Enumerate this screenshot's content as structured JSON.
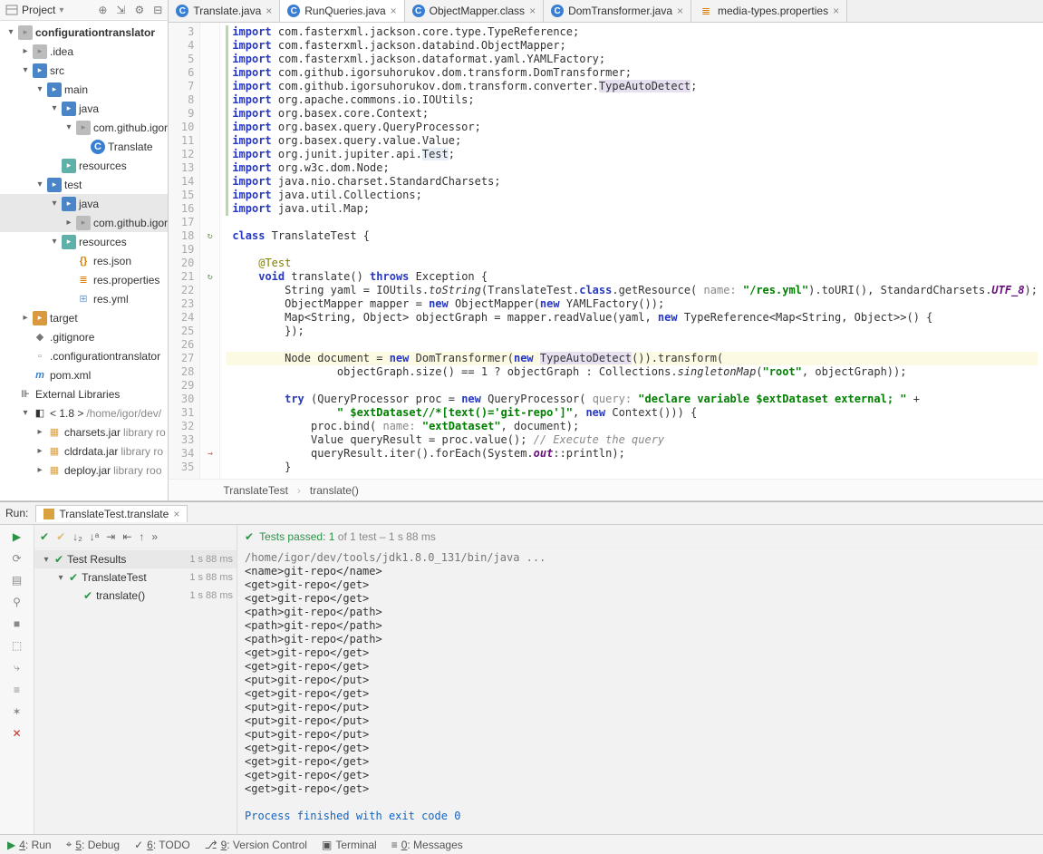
{
  "project_panel": {
    "title": "Project",
    "tree": [
      {
        "d": 0,
        "a": "down",
        "i": "folder",
        "ic": "gray",
        "l": "configurationtranslator",
        "bold": true,
        "hl": false
      },
      {
        "d": 1,
        "a": "right",
        "i": "folder",
        "ic": "gray",
        "l": ".idea"
      },
      {
        "d": 1,
        "a": "down",
        "i": "folder",
        "ic": "folder",
        "l": "src"
      },
      {
        "d": 2,
        "a": "down",
        "i": "folder",
        "ic": "folder",
        "l": "main"
      },
      {
        "d": 3,
        "a": "down",
        "i": "folder",
        "ic": "folder",
        "l": "java"
      },
      {
        "d": 4,
        "a": "down",
        "i": "folder",
        "ic": "gray",
        "l": "com.github.igor"
      },
      {
        "d": 5,
        "a": "",
        "i": "class",
        "l": "Translate",
        "sel": false
      },
      {
        "d": 3,
        "a": "",
        "i": "folder",
        "ic": "teal",
        "l": "resources"
      },
      {
        "d": 2,
        "a": "down",
        "i": "folder",
        "ic": "folder",
        "l": "test"
      },
      {
        "d": 3,
        "a": "down",
        "i": "folder",
        "ic": "folder",
        "l": "java",
        "hl": true
      },
      {
        "d": 4,
        "a": "right",
        "i": "folder",
        "ic": "gray",
        "l": "com.github.igor",
        "hl": true
      },
      {
        "d": 3,
        "a": "down",
        "i": "folder",
        "ic": "teal",
        "l": "resources"
      },
      {
        "d": 4,
        "a": "",
        "i": "json",
        "l": "res.json"
      },
      {
        "d": 4,
        "a": "",
        "i": "props",
        "l": "res.properties"
      },
      {
        "d": 4,
        "a": "",
        "i": "yml",
        "l": "res.yml"
      },
      {
        "d": 1,
        "a": "right",
        "i": "folder",
        "ic": "orange",
        "l": "target"
      },
      {
        "d": 1,
        "a": "",
        "i": "gitignore",
        "l": ".gitignore"
      },
      {
        "d": 1,
        "a": "",
        "i": "gray",
        "l": ".configurationtranslator"
      },
      {
        "d": 1,
        "a": "",
        "i": "xml",
        "l": "pom.xml"
      },
      {
        "d": 0,
        "a": "",
        "i": "lib",
        "l": "External Libraries"
      },
      {
        "d": 1,
        "a": "down",
        "i": "jdk",
        "l": "< 1.8 >",
        "suffix": "/home/igor/dev/"
      },
      {
        "d": 2,
        "a": "right",
        "i": "jar",
        "l": "charsets.jar",
        "suffix": "library ro"
      },
      {
        "d": 2,
        "a": "right",
        "i": "jar",
        "l": "cldrdata.jar",
        "suffix": "library ro"
      },
      {
        "d": 2,
        "a": "right",
        "i": "jar",
        "l": "deploy.jar",
        "suffix": "library roo"
      }
    ]
  },
  "tabs": [
    {
      "icon": "class",
      "label": "Translate.java"
    },
    {
      "icon": "class",
      "label": "RunQueries.java",
      "active": true
    },
    {
      "icon": "class",
      "label": "ObjectMapper.class"
    },
    {
      "icon": "class",
      "label": "DomTransformer.java"
    },
    {
      "icon": "props",
      "label": "media-types.properties"
    }
  ],
  "editor": {
    "first_line": 3,
    "lines": [
      {
        "n": 3,
        "sb": "g",
        "html": "<span class='kw'>import</span> com.fasterxml.jackson.core.type.TypeReference;"
      },
      {
        "n": 4,
        "sb": "g",
        "html": "<span class='kw'>import</span> com.fasterxml.jackson.databind.ObjectMapper;"
      },
      {
        "n": 5,
        "sb": "g",
        "html": "<span class='kw'>import</span> com.fasterxml.jackson.dataformat.yaml.YAMLFactory;"
      },
      {
        "n": 6,
        "sb": "g",
        "html": "<span class='kw'>import</span> com.github.igorsuhorukov.dom.transform.DomTransformer;"
      },
      {
        "n": 7,
        "sb": "g",
        "html": "<span class='kw'>import</span> com.github.igorsuhorukov.dom.transform.converter.<span style='background:#e6e0f0'>TypeAutoDetect</span>;"
      },
      {
        "n": 8,
        "sb": "g",
        "html": "<span class='kw'>import</span> org.apache.commons.io.IOUtils;"
      },
      {
        "n": 9,
        "sb": "g",
        "html": "<span class='kw'>import</span> org.basex.core.Context;"
      },
      {
        "n": 10,
        "sb": "g",
        "html": "<span class='kw'>import</span> org.basex.query.QueryProcessor;"
      },
      {
        "n": 11,
        "sb": "g",
        "html": "<span class='kw'>import</span> org.basex.query.value.Value;"
      },
      {
        "n": 12,
        "sb": "g",
        "html": "<span class='kw'>import</span> org.junit.jupiter.api.<span style='background:#e8eef6'>Test</span>;"
      },
      {
        "n": 13,
        "sb": "g",
        "html": "<span class='kw'>import</span> org.w3c.dom.Node;"
      },
      {
        "n": 14,
        "sb": "g",
        "html": "<span class='kw'>import</span> java.nio.charset.StandardCharsets;"
      },
      {
        "n": 15,
        "sb": "g",
        "html": "<span class='kw'>import</span> java.util.Collections;"
      },
      {
        "n": 16,
        "sb": "g",
        "html": "<span class='kw'>import</span> java.util.Map;"
      },
      {
        "n": 17,
        "html": ""
      },
      {
        "n": 18,
        "mark": "↻",
        "html": "<span class='kw'>class</span> TranslateTest {"
      },
      {
        "n": 19,
        "html": ""
      },
      {
        "n": 20,
        "html": "    <span class='ann'>@Test</span>"
      },
      {
        "n": 21,
        "mark": "↻",
        "html": "    <span class='kw'>void</span> translate() <span class='kw'>throws</span> Exception {"
      },
      {
        "n": 22,
        "html": "        String yaml = IOUtils.<span class='statm'>toString</span>(TranslateTest.<span class='kw'>class</span>.getResource( <span class='param'>name:</span> <span class='str'>\"/res.yml\"</span>).toURI(), StandardCharsets.<span class='staticfld'>UTF_8</span>);"
      },
      {
        "n": 23,
        "html": "        ObjectMapper mapper = <span class='kw'>new</span> ObjectMapper(<span class='kw'>new</span> YAMLFactory());"
      },
      {
        "n": 24,
        "html": "        Map&lt;String, Object&gt; objectGraph = mapper.readValue(yaml, <span class='kw'>new</span> TypeReference&lt;Map&lt;String, Object&gt;&gt;() {"
      },
      {
        "n": 25,
        "html": "        });"
      },
      {
        "n": 26,
        "html": ""
      },
      {
        "n": 27,
        "hl": true,
        "html": "        Node document = <span class='kw'>new</span> DomTransformer(<span class='kw'>new</span> <span style='background:#e6e0f0'>TypeAutoDetect</span>()).transform("
      },
      {
        "n": 28,
        "html": "                objectGraph.size() == 1 ? objectGraph : Collections.<span class='statm'>singletonMap</span>(<span class='str'>\"root\"</span>, objectGraph));"
      },
      {
        "n": 29,
        "html": ""
      },
      {
        "n": 30,
        "html": "        <span class='kw'>try</span> (QueryProcessor proc = <span class='kw'>new</span> QueryProcessor( <span class='param'>query:</span> <span class='str'>\"declare variable $extDataset external; \"</span> +"
      },
      {
        "n": 31,
        "html": "                <span class='str'>\" $extDataset//*[text()='git-repo']\"</span>, <span class='kw'>new</span> Context())) {"
      },
      {
        "n": 32,
        "html": "            proc.bind( <span class='param'>name:</span> <span class='str'>\"extDataset\"</span>, document);"
      },
      {
        "n": 33,
        "html": "            Value queryResult = proc.value(); <span class='cmt'>// Execute the query</span>"
      },
      {
        "n": 34,
        "mark": "→",
        "html": "            queryResult.iter().forEach(System.<span class='staticfld'>out</span>::println);"
      },
      {
        "n": 35,
        "html": "        }"
      }
    ],
    "breadcrumb": [
      "TranslateTest",
      "translate()"
    ]
  },
  "run": {
    "label": "Run:",
    "tab": "TranslateTest.translate",
    "tests_passed": "Tests passed: 1",
    "tests_total": " of 1 test – 1 s 88 ms",
    "tree": [
      {
        "d": 0,
        "l": "Test Results",
        "time": "1 s 88 ms",
        "root": true
      },
      {
        "d": 1,
        "l": "TranslateTest",
        "time": "1 s 88 ms"
      },
      {
        "d": 2,
        "l": "translate()",
        "time": "1 s 88 ms"
      }
    ],
    "console": {
      "cmd": "/home/igor/dev/tools/jdk1.8.0_131/bin/java ...",
      "lines": [
        "<name>git-repo</name>",
        "<get>git-repo</get>",
        "<get>git-repo</get>",
        "<path>git-repo</path>",
        "<path>git-repo</path>",
        "<path>git-repo</path>",
        "<get>git-repo</get>",
        "<get>git-repo</get>",
        "<put>git-repo</put>",
        "<get>git-repo</get>",
        "<put>git-repo</put>",
        "<put>git-repo</put>",
        "<put>git-repo</put>",
        "<get>git-repo</get>",
        "<get>git-repo</get>",
        "<get>git-repo</get>",
        "<get>git-repo</get>"
      ],
      "exit": "Process finished with exit code 0"
    }
  },
  "status_bar": [
    {
      "icon": "▶",
      "color": "green",
      "label": "4: Run"
    },
    {
      "icon": "⌖",
      "label": "5: Debug"
    },
    {
      "icon": "✓",
      "label": "6: TODO"
    },
    {
      "icon": "⎇",
      "label": "9: Version Control"
    },
    {
      "icon": "▣",
      "label": "Terminal"
    },
    {
      "icon": "≡",
      "label": "0: Messages"
    }
  ],
  "icons": {
    "folder": "▸",
    "class": "C",
    "json": "{}",
    "props": "≣",
    "yml": "⊞",
    "xml": "m",
    "gitignore": "◆",
    "gray": "▫",
    "jar": "▦",
    "jdk": "◧",
    "lib": "⊪"
  }
}
